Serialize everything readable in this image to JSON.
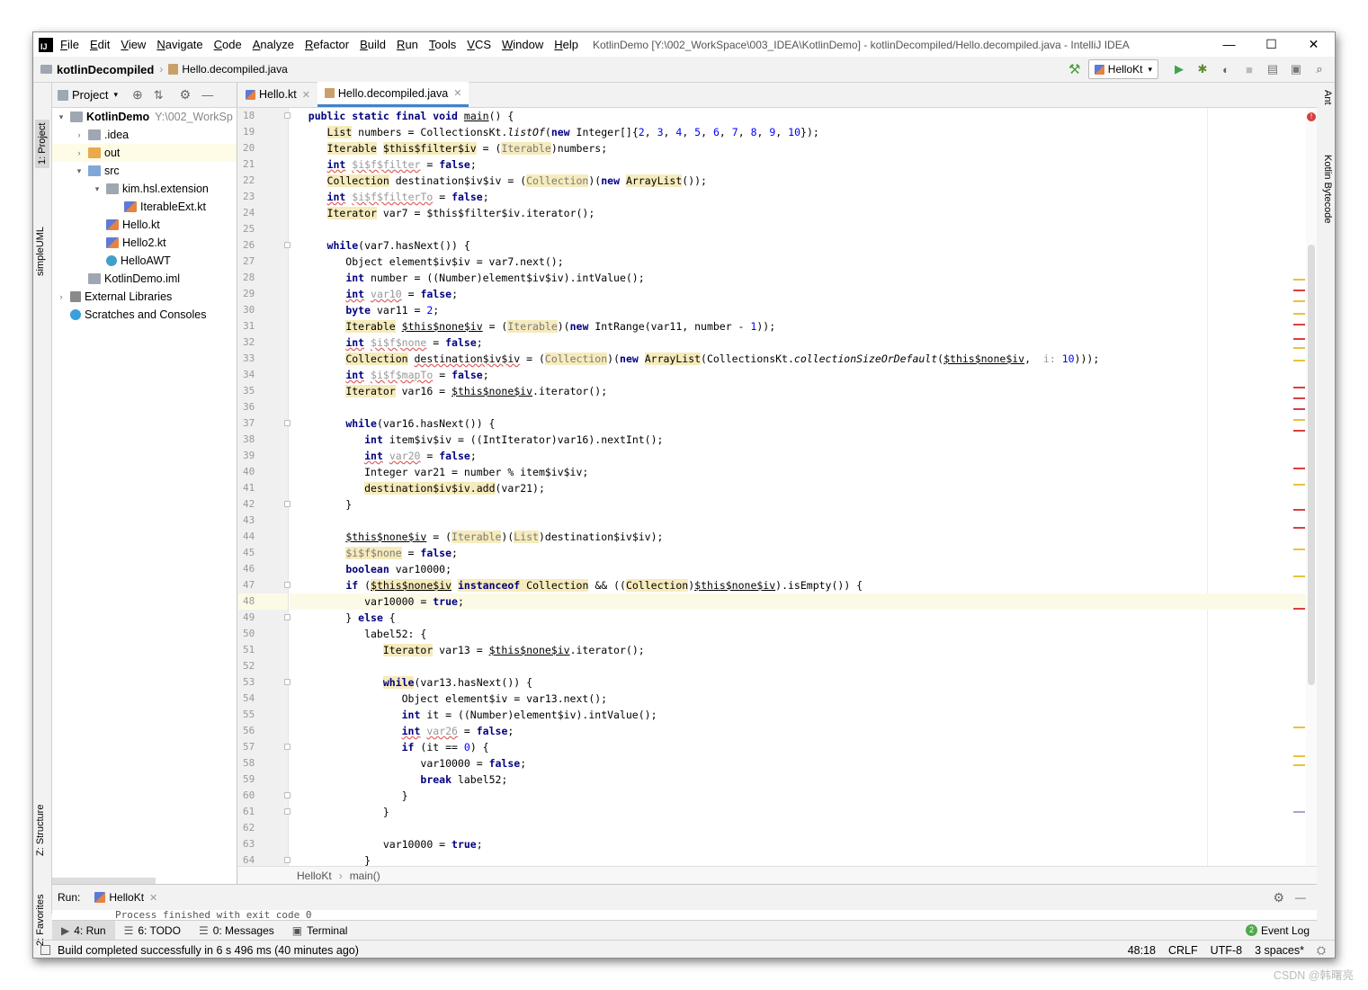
{
  "window": {
    "app_logo": "IJ",
    "menu": [
      "File",
      "Edit",
      "View",
      "Navigate",
      "Code",
      "Analyze",
      "Refactor",
      "Build",
      "Run",
      "Tools",
      "VCS",
      "Window",
      "Help"
    ],
    "title": "KotlinDemo [Y:\\002_WorkSpace\\003_IDEA\\KotlinDemo] - kotlinDecompiled/Hello.decompiled.java - IntelliJ IDEA",
    "controls": [
      "—",
      "☐",
      "✕"
    ]
  },
  "navbar": {
    "project": "kotlinDecompiled",
    "file": "Hello.decompiled.java",
    "run_config": "HelloKt"
  },
  "left_stripe": {
    "project": "1: Project",
    "uml": "simpleUML",
    "structure": "Z: Structure",
    "favorites": "2: Favorites"
  },
  "right_stripe": {
    "ant": "Ant",
    "bytecode": "Kotlin Bytecode"
  },
  "project_panel": {
    "title": "Project",
    "tree": [
      {
        "label": "KotlinDemo",
        "extra": "Y:\\002_WorkSp",
        "arrow": "▾",
        "icon": "folder",
        "indent": 0,
        "bold": true
      },
      {
        "label": ".idea",
        "arrow": "›",
        "icon": "folder",
        "indent": 1
      },
      {
        "label": "out",
        "arrow": "›",
        "icon": "orange",
        "indent": 1,
        "sel": true
      },
      {
        "label": "src",
        "arrow": "▾",
        "icon": "blue",
        "indent": 1
      },
      {
        "label": "kim.hsl.extension",
        "arrow": "▾",
        "icon": "folder",
        "indent": 2
      },
      {
        "label": "IterableExt.kt",
        "arrow": "",
        "icon": "kt",
        "indent": 3
      },
      {
        "label": "Hello.kt",
        "arrow": "",
        "icon": "kt",
        "indent": 2
      },
      {
        "label": "Hello2.kt",
        "arrow": "",
        "icon": "kt",
        "indent": 2
      },
      {
        "label": "HelloAWT",
        "arrow": "",
        "icon": "java",
        "indent": 2
      },
      {
        "label": "KotlinDemo.iml",
        "arrow": "",
        "icon": "iml",
        "indent": 1
      },
      {
        "label": "External Libraries",
        "arrow": "›",
        "icon": "lib",
        "indent": 0
      },
      {
        "label": "Scratches and Consoles",
        "arrow": "",
        "icon": "scr",
        "indent": 0
      }
    ]
  },
  "editor": {
    "tabs": [
      {
        "label": "Hello.kt",
        "active": false
      },
      {
        "label": "Hello.decompiled.java",
        "active": true
      }
    ],
    "current_line": 48,
    "lines": [
      {
        "n": 18,
        "fold": true,
        "html": "   <span class='kw'>public static final void</span> <span class='ul'>main</span>() {"
      },
      {
        "n": 19,
        "html": "      <span class='hl'>List</span> numbers = CollectionsKt.<span class='it'>listOf</span>(<span class='kw'>new</span> Integer[]{<span class='num'>2</span>, <span class='num'>3</span>, <span class='num'>4</span>, <span class='num'>5</span>, <span class='num'>6</span>, <span class='num'>7</span>, <span class='num'>8</span>, <span class='num'>9</span>, <span class='num'>10</span>});"
      },
      {
        "n": 20,
        "html": "      <span class='hl'>Iterable</span> <span class='hl'>$this$filter$iv</span> = (<span class='hlg'>Iterable</span>)numbers;"
      },
      {
        "n": 21,
        "html": "      <span class='kw wave'>int</span> <span class='gr wave'>$i$f$filter</span> = <span class='kw'>false</span>;"
      },
      {
        "n": 22,
        "html": "      <span class='hl'>Collection</span> destination$iv$iv = (<span class='hlg'>Collection</span>)(<span class='kw'>new</span> <span class='hl'>ArrayList</span>());"
      },
      {
        "n": 23,
        "html": "      <span class='kw wave'>int</span> <span class='gr wave'>$i$f$filterTo</span> = <span class='kw'>false</span>;"
      },
      {
        "n": 24,
        "html": "      <span class='hl'>Iterator</span> var7 = $this$filter$iv.iterator();"
      },
      {
        "n": 25,
        "html": ""
      },
      {
        "n": 26,
        "fold": true,
        "html": "      <span class='kw'>while</span>(var7.hasNext()) {"
      },
      {
        "n": 27,
        "html": "         Object element$iv$iv = var7.next();"
      },
      {
        "n": 28,
        "html": "         <span class='kw'>int</span> number = ((Number)element$iv$iv).intValue();"
      },
      {
        "n": 29,
        "html": "         <span class='kw wave'>int</span> <span class='gr wave'>var10</span> = <span class='kw'>false</span>;"
      },
      {
        "n": 30,
        "html": "         <span class='kw'>byte</span> var11 = <span class='num'>2</span>;"
      },
      {
        "n": 31,
        "html": "         <span class='hl'>Iterable</span> <span class='ul'>$this$none$iv</span> = (<span class='hlg'>Iterable</span>)(<span class='kw'>new</span> IntRange(var11, number - <span class='num'>1</span>));"
      },
      {
        "n": 32,
        "html": "         <span class='kw wave'>int</span> <span class='gr wave'>$i$f$none</span> = <span class='kw'>false</span>;"
      },
      {
        "n": 33,
        "html": "         <span class='hl'>Collection</span> <span class='wave'>destination$iv$iv</span> = (<span class='hlg'>Collection</span>)(<span class='kw'>new</span> <span class='hl'>ArrayList</span>(CollectionsKt.<span class='it'>collectionSizeOrDefault</span>(<span class='ul'>$this$none$iv</span>,  <span class='gr'>i:</span> <span class='num'>10</span>)));"
      },
      {
        "n": 34,
        "html": "         <span class='kw wave'>int</span> <span class='gr wave'>$i$f$mapTo</span> = <span class='kw'>false</span>;"
      },
      {
        "n": 35,
        "html": "         <span class='hl'>Iterator</span> var16 = <span class='ul'>$this$none$iv</span>.iterator();"
      },
      {
        "n": 36,
        "html": ""
      },
      {
        "n": 37,
        "fold": true,
        "html": "         <span class='kw'>while</span>(var16.hasNext()) {"
      },
      {
        "n": 38,
        "html": "            <span class='kw'>int</span> item$iv$iv = ((IntIterator)var16).nextInt();"
      },
      {
        "n": 39,
        "html": "            <span class='kw wave'>int</span> <span class='gr wave'>var20</span> = <span class='kw'>false</span>;"
      },
      {
        "n": 40,
        "html": "            Integer var21 = number % item$iv$iv;"
      },
      {
        "n": 41,
        "html": "            <span class='hl'>destination$iv$iv.add</span>(var21);"
      },
      {
        "n": 42,
        "fold": true,
        "html": "         }"
      },
      {
        "n": 43,
        "html": ""
      },
      {
        "n": 44,
        "html": "         <span class='ul'>$this$none$iv</span> = (<span class='hlg'>Iterable</span>)(<span class='hlg'>List</span>)destination$iv$iv);"
      },
      {
        "n": 45,
        "html": "         <span class='hlg'>$i$f$none</span> = <span class='kw'>false</span>;"
      },
      {
        "n": 46,
        "html": "         <span class='kw'>boolean</span> var10000;"
      },
      {
        "n": 47,
        "fold": true,
        "html": "         <span class='kw'>if</span> (<span class='hl ul'>$this$none$iv</span> <span class='hl'><span class='kw'>instanceof</span> Collection</span> &amp;&amp; ((<span class='hl'>Collection</span>)<span class='ul'>$this$none$iv</span>).isEmpty()) {"
      },
      {
        "n": 48,
        "html": "            var10000 = <span class='kw'>true</span>;"
      },
      {
        "n": 49,
        "fold": true,
        "html": "         } <span class='kw'>else</span> {"
      },
      {
        "n": 50,
        "html": "            label52: {"
      },
      {
        "n": 51,
        "html": "               <span class='hl'>Iterator</span> var13 = <span class='ul'>$this$none$iv</span>.iterator();"
      },
      {
        "n": 52,
        "html": ""
      },
      {
        "n": 53,
        "fold": true,
        "html": "               <span class='hl'><span class='kw'>while</span></span>(var13.hasNext()) {"
      },
      {
        "n": 54,
        "html": "                  Object element$iv = var13.next();"
      },
      {
        "n": 55,
        "html": "                  <span class='kw'>int</span> it = ((Number)element$iv).intValue();"
      },
      {
        "n": 56,
        "html": "                  <span class='kw wave'>int</span> <span class='gr wave'>var26</span> = <span class='kw'>false</span>;"
      },
      {
        "n": 57,
        "fold": true,
        "html": "                  <span class='kw'>if</span> (it == <span class='num'>0</span>) {"
      },
      {
        "n": 58,
        "html": "                     var10000 = <span class='kw'>false</span>;"
      },
      {
        "n": 59,
        "html": "                     <span class='kw'>break</span> label52;"
      },
      {
        "n": 60,
        "fold": true,
        "html": "                  }"
      },
      {
        "n": 61,
        "fold": true,
        "html": "               }"
      },
      {
        "n": 62,
        "html": ""
      },
      {
        "n": 63,
        "html": "               var10000 = <span class='kw'>true</span>;"
      },
      {
        "n": 64,
        "fold": true,
        "html": "            }"
      }
    ],
    "breadcrumb": [
      "HelloKt",
      "main()"
    ],
    "error_badge": "!"
  },
  "run_panel": {
    "label": "Run:",
    "config": "HelloKt",
    "output": "Process finished with exit code 0"
  },
  "bottom_tabs": [
    {
      "label": "4: Run",
      "icon": "▶",
      "active": true
    },
    {
      "label": "6: TODO",
      "icon": "☰",
      "active": false
    },
    {
      "label": "0: Messages",
      "icon": "☰",
      "active": false
    },
    {
      "label": "Terminal",
      "icon": "▣",
      "active": false
    }
  ],
  "event_log": {
    "count": "2",
    "label": "Event Log"
  },
  "status": {
    "message": "Build completed successfully in 6 s 496 ms (40 minutes ago)",
    "position": "48:18",
    "line_sep": "CRLF",
    "encoding": "UTF-8",
    "indent": "3 spaces*"
  },
  "watermark": "CSDN @韩曙亮",
  "colors": {
    "accent": "#4083c9",
    "keyword": "#000080",
    "number": "#0000ff",
    "highlight": "#f6ebbc",
    "error": "#e06060"
  }
}
